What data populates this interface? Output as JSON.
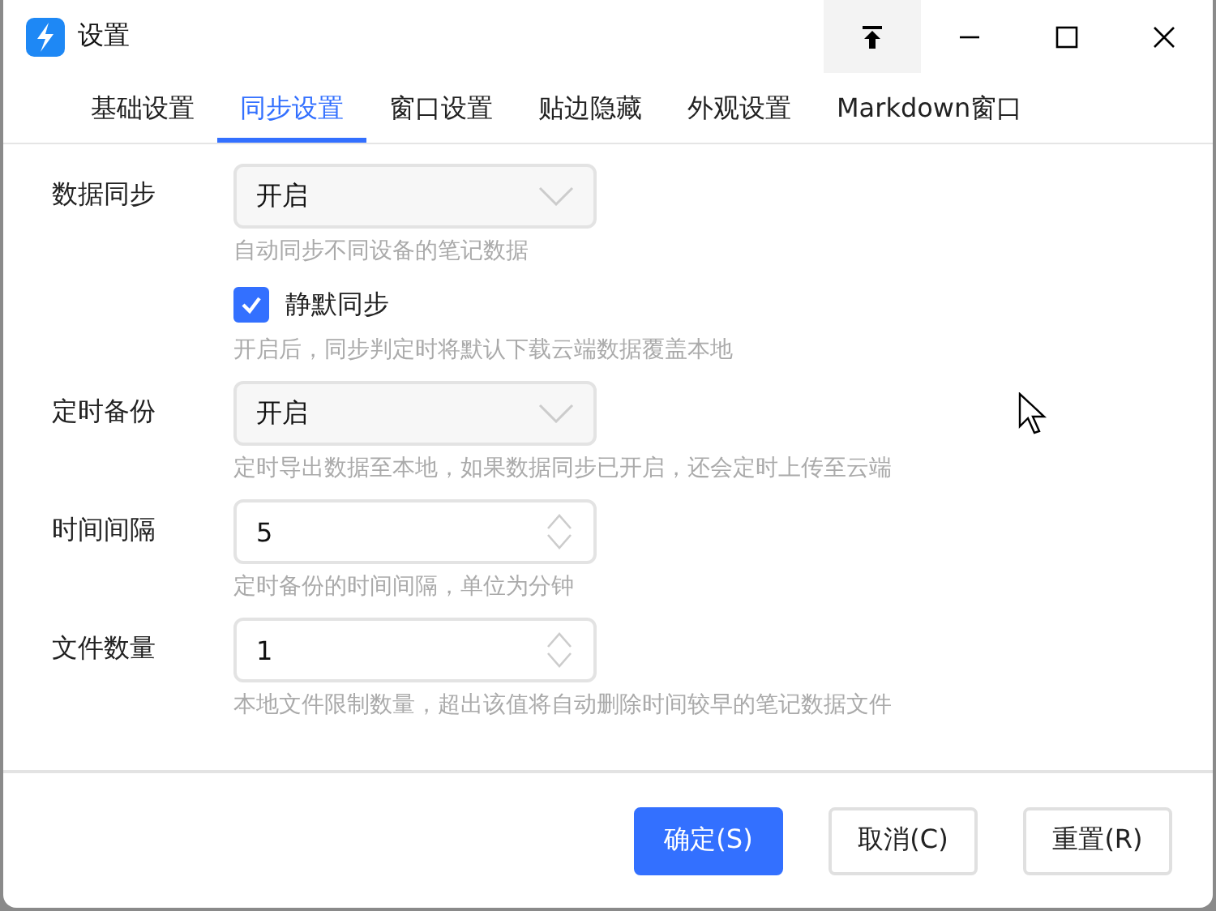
{
  "window": {
    "title": "设置"
  },
  "tabs": [
    {
      "label": "基础设置",
      "selected": false
    },
    {
      "label": "同步设置",
      "selected": true
    },
    {
      "label": "窗口设置",
      "selected": false
    },
    {
      "label": "贴边隐藏",
      "selected": false
    },
    {
      "label": "外观设置",
      "selected": false
    },
    {
      "label": "Markdown窗口",
      "selected": false
    }
  ],
  "settings": [
    {
      "kind": "select",
      "label": "数据同步",
      "value": "开启",
      "hint": "自动同步不同设备的笔记数据"
    },
    {
      "kind": "checkbox",
      "label": "静默同步",
      "checked": true,
      "hint": "开启后，同步判定时将默认下载云端数据覆盖本地"
    },
    {
      "kind": "select",
      "label": "定时备份",
      "value": "开启",
      "hint": "定时导出数据至本地，如果数据同步已开启，还会定时上传至云端"
    },
    {
      "kind": "number",
      "label": "时间间隔",
      "value": "5",
      "hint": "定时备份的时间间隔，单位为分钟"
    },
    {
      "kind": "number",
      "label": "文件数量",
      "value": "1",
      "hint": "本地文件限制数量，超出该值将自动删除时间较早的笔记数据文件"
    }
  ],
  "buttons": [
    {
      "label": "确定(S)",
      "primary": true
    },
    {
      "label": "取消(C)",
      "primary": false
    },
    {
      "label": "重置(R)",
      "primary": false
    }
  ]
}
